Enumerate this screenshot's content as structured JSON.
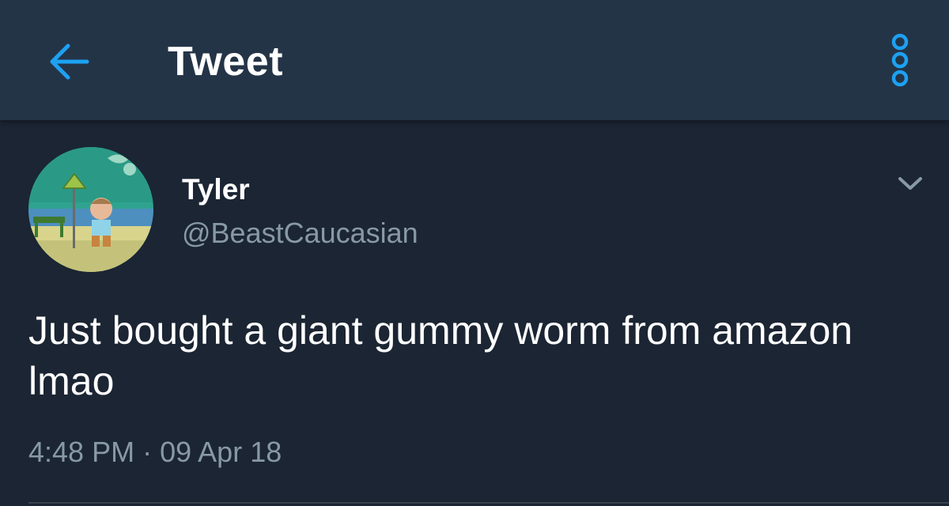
{
  "app_bar": {
    "title": "Tweet",
    "back_icon": "arrow-left-icon",
    "overflow_icon": "vertical-dots-icon",
    "accent_color": "#1da1f2"
  },
  "tweet": {
    "author": {
      "display_name": "Tyler",
      "handle": "@BeastCaucasian"
    },
    "text": "Just bought a giant gummy worm from amazon lmao",
    "time": "4:48 PM",
    "separator": "·",
    "date": "09 Apr 18",
    "menu_icon": "chevron-down-icon"
  },
  "colors": {
    "background": "#1b2533",
    "header": "#243447",
    "secondary_text": "#8899a6",
    "divider": "#38444d"
  }
}
